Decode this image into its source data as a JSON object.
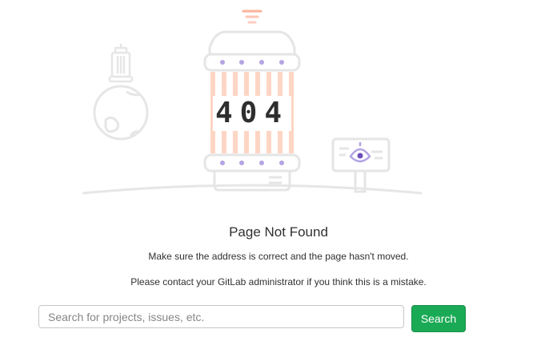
{
  "illustration": {
    "code": "404",
    "colors": {
      "outline": "#e5e5e5",
      "stripe": "#fdd5c4",
      "dot": "#b3a4e3",
      "code_text": "#2e2e2e",
      "accent": "#fc9f81"
    }
  },
  "error": {
    "title": "Page Not Found",
    "message": "Make sure the address is correct and the page hasn't moved.",
    "contact": "Please contact your GitLab administrator if you think this is a mistake."
  },
  "search": {
    "placeholder": "Search for projects, issues, etc.",
    "value": "",
    "button_label": "Search",
    "button_color": "#1aaa55"
  }
}
